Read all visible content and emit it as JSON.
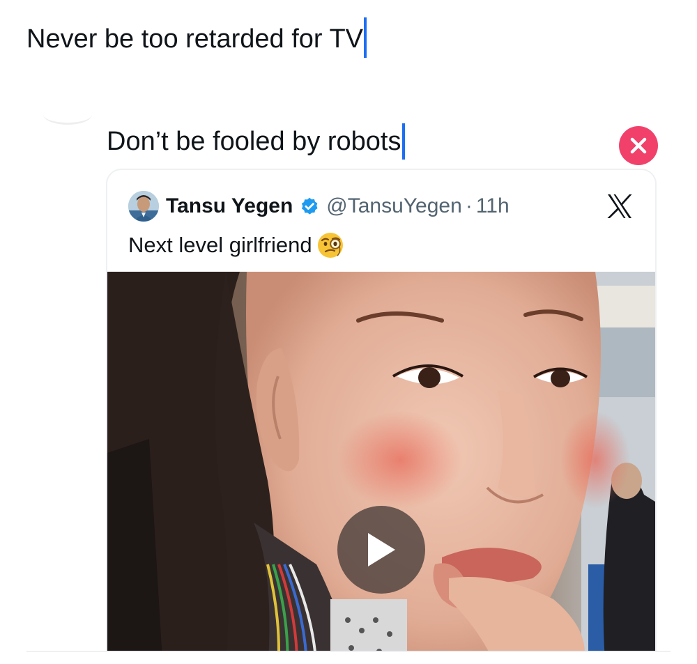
{
  "composer": {
    "main_text": "Never be too retarded for TV",
    "quote_text": "Don’t be fooled by robots"
  },
  "colors": {
    "caret": "#1d6ff2",
    "remove_button": "#f1416b",
    "verified": "#1d9bf0",
    "secondary_text": "#536471"
  },
  "quoted_tweet": {
    "author_name": "Tansu Yegen",
    "handle": "@TansuYegen",
    "separator": "·",
    "time": "11h",
    "text": "Next level girlfriend",
    "emoji": "face-with-monocle-emoji",
    "verified_icon": "verified-badge-icon",
    "platform_icon": "x-logo-icon",
    "media": {
      "type": "video",
      "play_icon": "play-icon"
    }
  },
  "remove_icon": "close-icon"
}
